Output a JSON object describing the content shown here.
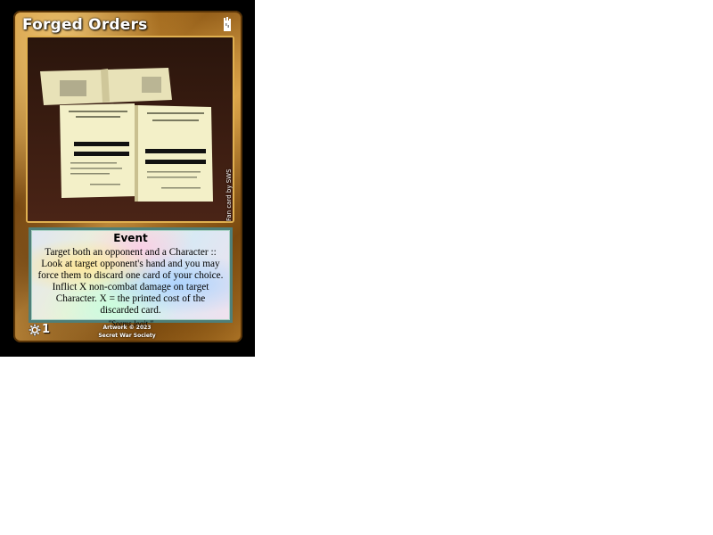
{
  "card": {
    "title": "Forged Orders",
    "type_icon": "tower-icon",
    "side_credit": "Fan card by SWS",
    "type_line": "Event",
    "rules_text": "Target both an opponent and a Character :: Look at target opponent's hand and you may force them to discard one card of your choice. Inflict X non-combat damage on target Character. X = the printed cost of the discarded card.",
    "flavor_text": "\"Seems legit.\"",
    "cost_icon": "gear-icon",
    "cost": "1",
    "artwork_credit_line1": "Artwork © 2023",
    "artwork_credit_line2": "Secret War Society",
    "art_description_icon": "documents-image"
  },
  "colors": {
    "frame_gold": "#c98a2c",
    "text_box_border": "#4f7f78",
    "background_black": "#000000"
  }
}
